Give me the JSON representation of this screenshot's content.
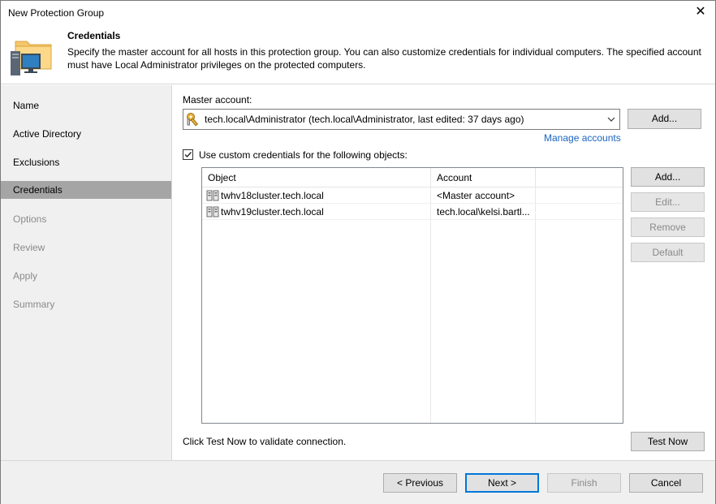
{
  "window": {
    "title": "New Protection Group"
  },
  "header": {
    "title": "Credentials",
    "description": "Specify the master account for all hosts in this protection group. You can also customize credentials for individual computers. The specified account must have Local Administrator privileges on the protected computers."
  },
  "sidebar": {
    "items": [
      {
        "label": "Name",
        "state": "enabled"
      },
      {
        "label": "Active Directory",
        "state": "enabled"
      },
      {
        "label": "Exclusions",
        "state": "enabled"
      },
      {
        "label": "Credentials",
        "state": "active"
      },
      {
        "label": "Options",
        "state": "disabled"
      },
      {
        "label": "Review",
        "state": "disabled"
      },
      {
        "label": "Apply",
        "state": "disabled"
      },
      {
        "label": "Summary",
        "state": "disabled"
      }
    ]
  },
  "main": {
    "master_label": "Master account:",
    "master_value": "tech.local\\Administrator (tech.local\\Administrator, last edited: 37 days ago)",
    "add_master_label": "Add...",
    "manage_accounts_label": "Manage accounts",
    "custom_creds_label": "Use custom credentials for the following objects:",
    "custom_creds_checked": true,
    "table": {
      "columns": [
        "Object",
        "Account"
      ],
      "rows": [
        {
          "object": "twhv18cluster.tech.local",
          "account": "<Master account>"
        },
        {
          "object": "twhv19cluster.tech.local",
          "account": "tech.local\\kelsi.bartl..."
        }
      ]
    },
    "side_buttons": {
      "add": "Add...",
      "edit": "Edit...",
      "remove": "Remove",
      "default": "Default"
    },
    "test_hint": "Click Test Now to validate connection.",
    "test_now_label": "Test Now"
  },
  "footer": {
    "previous_label": "< Previous",
    "next_label": "Next >",
    "finish_label": "Finish",
    "cancel_label": "Cancel"
  },
  "colors": {
    "link": "#1a65c0",
    "sidebar_bg": "#f0f0f0",
    "sidebar_active": "#a5a5a5",
    "primary_border": "#0078d7"
  }
}
